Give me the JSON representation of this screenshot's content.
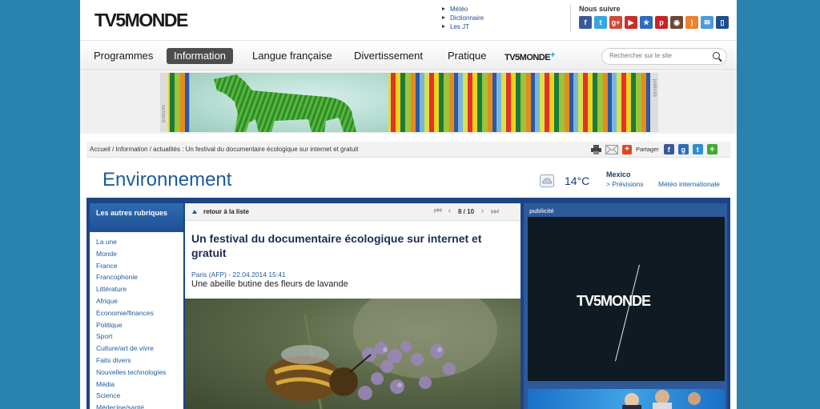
{
  "header": {
    "logo": "TV5MONDE",
    "top_links": [
      "Météo",
      "Dictionnaire",
      "Les JT"
    ],
    "follow_label": "Nous suivre",
    "social": [
      {
        "icon": "facebook-icon",
        "glyph": "f",
        "color": "#3b5998"
      },
      {
        "icon": "twitter-icon",
        "glyph": "t",
        "color": "#35a8e0"
      },
      {
        "icon": "google-plus-icon",
        "glyph": "g+",
        "color": "#d14836"
      },
      {
        "icon": "youtube-icon",
        "glyph": "▶",
        "color": "#c4302b"
      },
      {
        "icon": "badge-icon",
        "glyph": "★",
        "color": "#2d6bbd"
      },
      {
        "icon": "pinterest-icon",
        "glyph": "p",
        "color": "#cb2027"
      },
      {
        "icon": "instagram-icon",
        "glyph": "◉",
        "color": "#6b4a34"
      },
      {
        "icon": "rss-icon",
        "glyph": ")",
        "color": "#ee802f"
      },
      {
        "icon": "newsletter-icon",
        "glyph": "✉",
        "color": "#4d9bd6"
      },
      {
        "icon": "mobile-icon",
        "glyph": "▯",
        "color": "#1e4f8e"
      }
    ]
  },
  "nav": {
    "items": [
      "Programmes",
      "Information",
      "Langue française",
      "Divertissement",
      "Pratique"
    ],
    "active_index": 1,
    "tv5plus_label": "TV5MONDE",
    "tv5plus_mark": "+",
    "search_placeholder": "Rechercher sur le site"
  },
  "banner": {
    "label": "publicité"
  },
  "breadcrumb": "Accueil / Information / actualités : Un festival du documentaire écologique sur internet et gratuit",
  "share_label": "Partager",
  "section": {
    "title": "Environnement",
    "temperature": "14°C",
    "city": "Mexico",
    "forecast_link": "> Prévisions",
    "intl_weather_link": "Météo internationale"
  },
  "left": {
    "heading": "Les autres rubriques",
    "items": [
      "La une",
      "Monde",
      "France",
      "Francophonie",
      "Littérature",
      "Afrique",
      "Economie/finances",
      "Politique",
      "Sport",
      "Culture/art de vivre",
      "Faits divers",
      "Nouvelles technologies",
      "Média",
      "Science",
      "Médecine/santé"
    ]
  },
  "article": {
    "back_label": "retour à la liste",
    "pager": "8 / 10",
    "headline": "Un festival du documentaire écologique sur internet et gratuit",
    "dateline": "Paris (AFP) - 22.04.2014 15:41",
    "caption": "Une abeille butine des fleurs de lavande"
  },
  "right": {
    "pub_label": "publicité",
    "ad_brand": "TV5MONDE"
  }
}
